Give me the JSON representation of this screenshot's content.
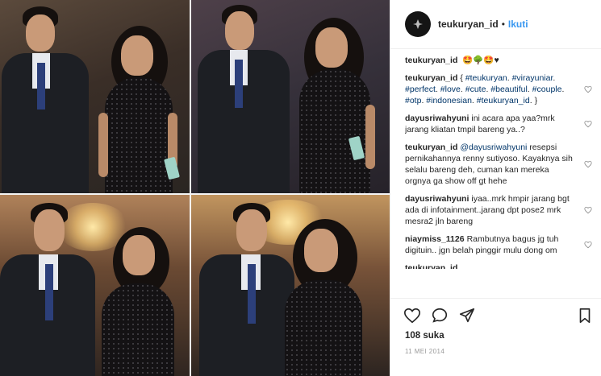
{
  "post": {
    "username": "teukuryan_id",
    "separator": "•",
    "follow_label": "Ikuti",
    "caption_user": "teukuryan_id",
    "caption_text": "🤩🌳🤩♥"
  },
  "comments": [
    {
      "user": "teukuryan_id",
      "segments": [
        {
          "t": "{ ",
          "tag": false
        },
        {
          "t": "#teukuryan",
          "tag": true
        },
        {
          "t": ". ",
          "tag": false
        },
        {
          "t": "#virayuniar",
          "tag": true
        },
        {
          "t": ". ",
          "tag": false
        },
        {
          "t": "#perfect",
          "tag": true
        },
        {
          "t": ". ",
          "tag": false
        },
        {
          "t": "#love",
          "tag": true
        },
        {
          "t": ". ",
          "tag": false
        },
        {
          "t": "#cute",
          "tag": true
        },
        {
          "t": ". ",
          "tag": false
        },
        {
          "t": "#beautiful",
          "tag": true
        },
        {
          "t": ". ",
          "tag": false
        },
        {
          "t": "#couple",
          "tag": true
        },
        {
          "t": ". ",
          "tag": false
        },
        {
          "t": "#otp",
          "tag": true
        },
        {
          "t": ". ",
          "tag": false
        },
        {
          "t": "#indonesian",
          "tag": true
        },
        {
          "t": ". ",
          "tag": false
        },
        {
          "t": "#teukuryan_id",
          "tag": true
        },
        {
          "t": ". }",
          "tag": false
        }
      ]
    },
    {
      "user": "dayusriwahyuni",
      "segments": [
        {
          "t": "ini acara apa yaa?mrk jarang kliatan tmpil bareng ya..?",
          "tag": false
        }
      ]
    },
    {
      "user": "teukuryan_id",
      "segments": [
        {
          "t": "@dayusriwahyuni",
          "tag": true
        },
        {
          "t": " resepsi pernikahannya renny sutiyoso. Kayaknya sih selalu bareng deh, cuman kan mereka orgnya ga show off gt hehe",
          "tag": false
        }
      ]
    },
    {
      "user": "dayusriwahyuni",
      "segments": [
        {
          "t": "iyaa..mrk hmpir jarang bgt ada di infotainment..jarang dpt pose2 mrk mesra2 jln bareng",
          "tag": false
        }
      ]
    },
    {
      "user": "niaymiss_1126",
      "segments": [
        {
          "t": "Rambutnya bagus jg tuh digituin.. jgn belah pinggir mulu dong om",
          "tag": false
        }
      ]
    }
  ],
  "actions": {
    "like_icon": "heart-outline-icon",
    "comment_icon": "speech-bubble-icon",
    "share_icon": "paper-plane-icon",
    "save_icon": "bookmark-icon"
  },
  "likes_text": "108 suka",
  "date_text": "11 MEI 2014",
  "colors": {
    "link": "#3897f0",
    "hashtag": "#003569",
    "muted": "#999999",
    "text": "#262626"
  }
}
